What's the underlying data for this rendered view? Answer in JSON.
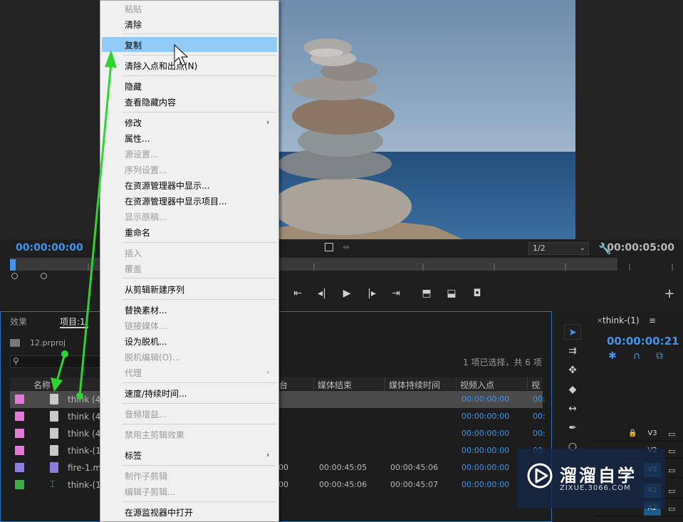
{
  "program_monitor": {
    "timecode_in": "00:00:00:00",
    "timecode_duration": "00:00:05:00",
    "resolution": "1/2"
  },
  "context_menu": {
    "items": [
      {
        "label": "粘贴",
        "enabled": false
      },
      {
        "label": "清除",
        "enabled": true
      },
      {
        "label": "复制",
        "enabled": true,
        "highlighted": true
      },
      {
        "label": "清除入点和出点(N)",
        "enabled": true
      },
      {
        "label": "隐藏",
        "enabled": true
      },
      {
        "label": "查看隐藏内容",
        "enabled": true
      },
      {
        "label": "修改",
        "enabled": true,
        "submenu": true
      },
      {
        "label": "属性...",
        "enabled": true
      },
      {
        "label": "源设置...",
        "enabled": false
      },
      {
        "label": "序列设置...",
        "enabled": false
      },
      {
        "label": "在资源管理器中显示...",
        "enabled": true
      },
      {
        "label": "在资源管理器中显示项目...",
        "enabled": true
      },
      {
        "label": "显示原稿...",
        "enabled": false
      },
      {
        "label": "重命名",
        "enabled": true
      },
      {
        "label": "插入",
        "enabled": false
      },
      {
        "label": "覆盖",
        "enabled": false
      },
      {
        "label": "从剪辑新建序列",
        "enabled": true
      },
      {
        "label": "替换素材...",
        "enabled": true
      },
      {
        "label": "链接媒体...",
        "enabled": false
      },
      {
        "label": "设为脱机...",
        "enabled": true
      },
      {
        "label": "脱机编辑(O)...",
        "enabled": false
      },
      {
        "label": "代理",
        "enabled": false,
        "submenu": true
      },
      {
        "label": "速度/持续时间...",
        "enabled": true
      },
      {
        "label": "音频增益...",
        "enabled": false
      },
      {
        "label": "禁用主剪辑效果",
        "enabled": false
      },
      {
        "label": "标签",
        "enabled": true,
        "submenu": true
      },
      {
        "label": "制作子剪辑",
        "enabled": false
      },
      {
        "label": "编辑子剪辑...",
        "enabled": false
      },
      {
        "label": "在源监视器中打开",
        "enabled": true
      }
    ]
  },
  "project_panel": {
    "tab_effects": "效果",
    "tab_project": "项目:1",
    "project_file": "12.prproj",
    "selection_status": "1 项已选择，共 6 项",
    "columns": [
      "名称",
      "台",
      "媒体结束",
      "媒体持续时间",
      "视频入点",
      "视"
    ],
    "rows": [
      {
        "name": "think (4)...",
        "color": "#e27ad6",
        "c1": "",
        "c2": "",
        "c3": "",
        "in": "00:00:00:00",
        "v": "00:",
        "selected": true
      },
      {
        "name": "think (4)...",
        "color": "#e27ad6",
        "c1": "",
        "c2": "",
        "c3": "",
        "in": "00:00:00:00",
        "v": "00:",
        "selected": false
      },
      {
        "name": "think (4)...",
        "color": "#e27ad6",
        "c1": "",
        "c2": "",
        "c3": "",
        "in": "00:00:00:00",
        "v": "00:",
        "selected": false
      },
      {
        "name": "think-(1)...",
        "color": "#e27ad6",
        "c1": "",
        "c2": "",
        "c3": "",
        "in": "00:00:00:00",
        "v": "00:",
        "selected": false
      },
      {
        "name": "fire-1.mp4",
        "color": "#8d7fe0",
        "c1": "00",
        "c2": "00:00:45:05",
        "c3": "00:00:45:06",
        "in": "00:00:00:00",
        "v": "",
        "selected": false
      },
      {
        "name": "think-(1)",
        "color": "#3fae49",
        "c1": "00",
        "c2": "00:00:45:06",
        "c3": "00:00:45:07",
        "in": "00:00:00:00",
        "v": "",
        "selected": false
      }
    ]
  },
  "timeline": {
    "sequence_name": "think-(1)",
    "timecode": "00:00:00:21",
    "tracks": [
      "V3",
      "V2",
      "V1",
      "A1",
      "A2"
    ]
  },
  "watermark": {
    "title": "溜溜自学",
    "subtitle": "ZIXUE.3066.COM"
  }
}
